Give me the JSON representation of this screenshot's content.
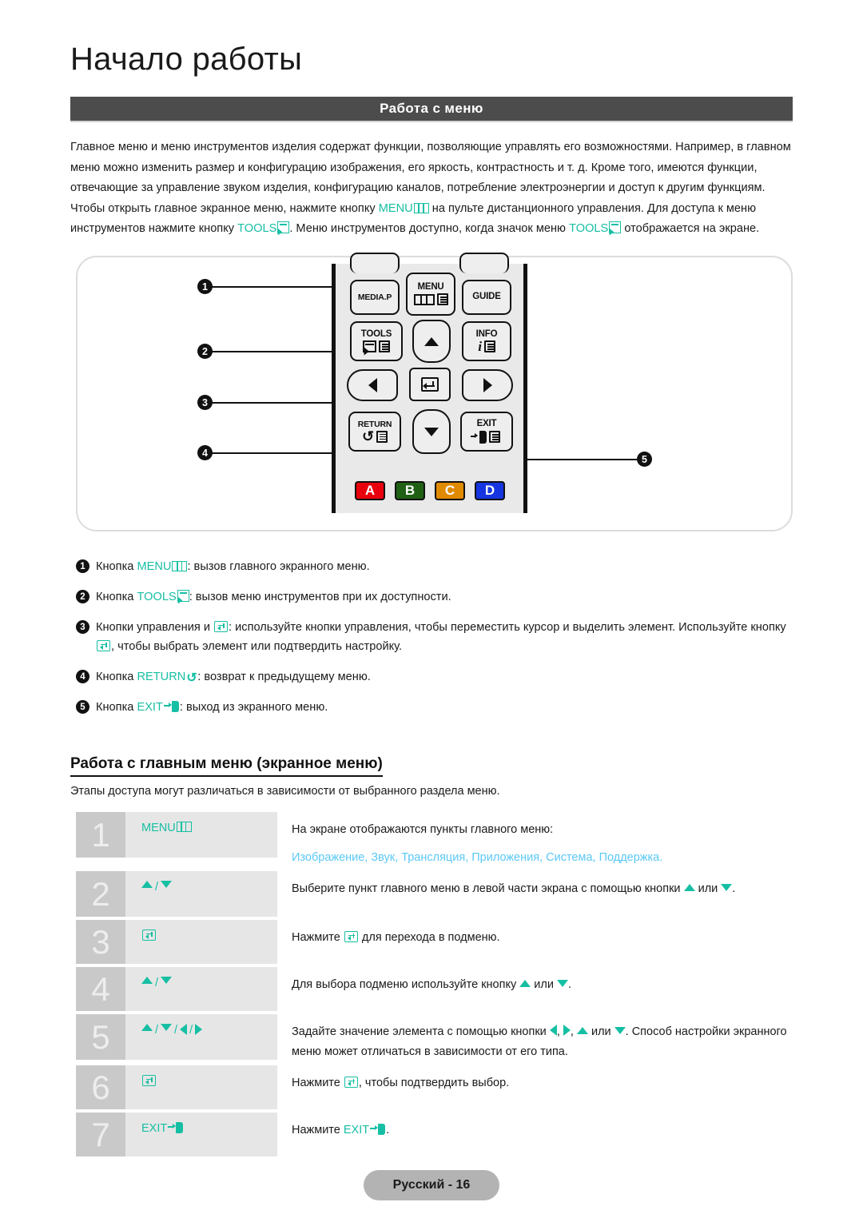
{
  "chapter": {
    "title": "Начало работы"
  },
  "section": {
    "title": "Работа с меню"
  },
  "intro": {
    "p1": "Главное меню и меню инструментов изделия содержат функции, позволяющие управлять его возможностями. Например, в главном меню можно изменить размер и конфигурацию изображения, его яркость, контрастность и т. д. Кроме того, имеются функции, отвечающие за управление звуком изделия, конфигурацию каналов, потребление электроэнергии и доступ к другим функциям. Чтобы открыть главное экранное меню, нажмите кнопку ",
    "menu_label": "MENU",
    "p2": " на пульте дистанционного управления. Для доступа к меню инструментов нажмите кнопку ",
    "tools_label": "TOOLS",
    "p3": ". Меню инструментов доступно, когда значок меню ",
    "tools_label2": "TOOLS",
    "p4": " отображается на экране."
  },
  "remote": {
    "buttons": {
      "media_p": "MEDIA.P",
      "menu": "MENU",
      "guide": "GUIDE",
      "tools": "TOOLS",
      "info": "INFO",
      "return": "RETURN",
      "exit": "EXIT"
    },
    "color_buttons": [
      {
        "label": "A",
        "color": "#e8000d"
      },
      {
        "label": "B",
        "color": "#1f6014"
      },
      {
        "label": "C",
        "color": "#e08a00"
      },
      {
        "label": "D",
        "color": "#1535e0"
      }
    ],
    "callouts": [
      "1",
      "2",
      "3",
      "4",
      "5"
    ]
  },
  "legend": [
    {
      "num": "1",
      "pre": "Кнопка ",
      "key": "MENU",
      "icon": "menu-icon",
      "post": ": вызов главного экранного меню."
    },
    {
      "num": "2",
      "pre": "Кнопка ",
      "key": "TOOLS",
      "icon": "tools-icon",
      "post": ": вызов меню инструментов при их доступности."
    },
    {
      "num": "3",
      "pre": "Кнопки управления и ",
      "key": "",
      "icon": "enter-icon",
      "post": ": используйте кнопки управления, чтобы переместить курсор и выделить элемент. Используйте кнопку ",
      "post2": ", чтобы выбрать элемент или подтвердить настройку."
    },
    {
      "num": "4",
      "pre": "Кнопка ",
      "key": "RETURN",
      "icon": "return-icon",
      "post": ": возврат к предыдущему меню."
    },
    {
      "num": "5",
      "pre": "Кнопка ",
      "key": "EXIT",
      "icon": "exit-icon",
      "post": ": выход из экранного меню."
    }
  ],
  "subsection": {
    "title": "Работа с главным меню (экранное меню)",
    "desc": "Этапы доступа могут различаться в зависимости от выбранного раздела меню."
  },
  "steps": [
    {
      "num": "1",
      "key_label": "MENU",
      "key_icon": "menu-icon",
      "desc": "На экране отображаются пункты главного меню:",
      "menu_items": "Изображение, Звук, Трансляция, Приложения, Система, Поддержка."
    },
    {
      "num": "2",
      "key_label": "",
      "key_icon": "up-down-icon",
      "desc_pre": "Выберите пункт главного меню в левой части экрана с помощью кнопки ",
      "desc_mid": " или ",
      "desc_post": "."
    },
    {
      "num": "3",
      "key_label": "",
      "key_icon": "enter-icon",
      "desc_pre": "Нажмите ",
      "desc_post": " для перехода в подменю."
    },
    {
      "num": "4",
      "key_label": "",
      "key_icon": "up-down-icon",
      "desc_pre": "Для выбора подменю используйте кнопку ",
      "desc_mid": " или ",
      "desc_post": "."
    },
    {
      "num": "5",
      "key_label": "",
      "key_icon": "up-down-left-right-icon",
      "desc_pre": "Задайте значение элемента с помощью кнопки ",
      "desc_mid": ", ",
      "desc_mid2": ", ",
      "desc_mid3": " или ",
      "desc_post": ". Способ настройки экранного меню может отличаться в зависимости от его типа."
    },
    {
      "num": "6",
      "key_label": "",
      "key_icon": "enter-icon",
      "desc_pre": "Нажмите ",
      "desc_post": ", чтобы подтвердить выбор."
    },
    {
      "num": "7",
      "key_label": "EXIT",
      "key_icon": "exit-icon",
      "desc_pre": "Нажмите ",
      "desc_key": "EXIT",
      "desc_post": "."
    }
  ],
  "footer": {
    "text": "Русский - 16"
  },
  "colors": {
    "accent_teal": "#16bfa3",
    "accent_cyan": "#5bc8f5",
    "header_bar": "#4c4c4c",
    "step_num_bg": "#c9c9c9",
    "step_key_bg": "#e6e6e6",
    "footer_bg": "#b3b3b3"
  }
}
